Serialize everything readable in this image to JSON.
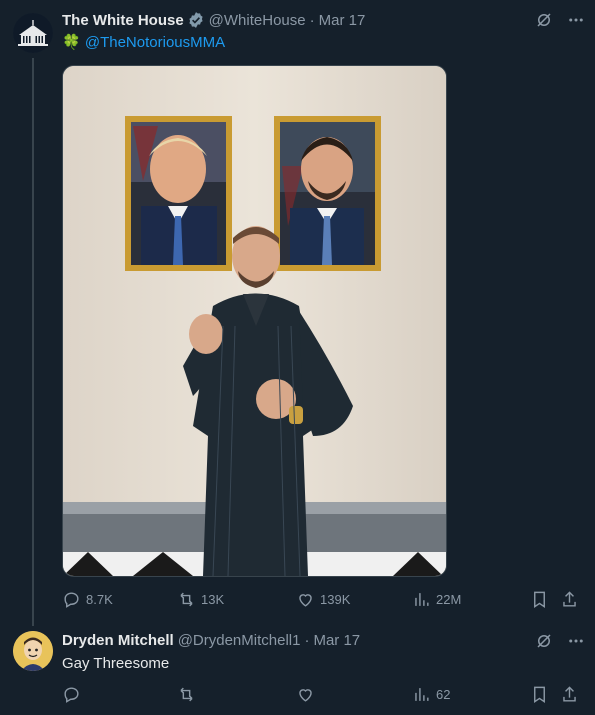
{
  "tweet1": {
    "display_name": "The White House",
    "handle": "@WhiteHouse",
    "separator": "·",
    "date": "Mar 17",
    "emoji": "🍀",
    "mention": "@TheNotoriousMMA",
    "actions": {
      "replies": "8.7K",
      "retweets": "13K",
      "likes": "139K",
      "views": "22M"
    },
    "icons": [
      "grok-icon",
      "more-icon",
      "reply-icon",
      "retweet-icon",
      "like-icon",
      "views-icon",
      "bookmark-icon",
      "share-icon"
    ]
  },
  "tweet2": {
    "display_name": "Dryden Mitchell",
    "handle": "@DrydenMitchell1",
    "separator": "·",
    "date": "Mar 17",
    "text": "Gay Threesome",
    "actions": {
      "replies": "",
      "retweets": "",
      "likes": "",
      "views": "62"
    }
  },
  "colors": {
    "background": "#15202b",
    "text": "#e7e9ea",
    "muted": "#8b98a5",
    "link": "#1d9bf0",
    "verified": "#829aab"
  }
}
